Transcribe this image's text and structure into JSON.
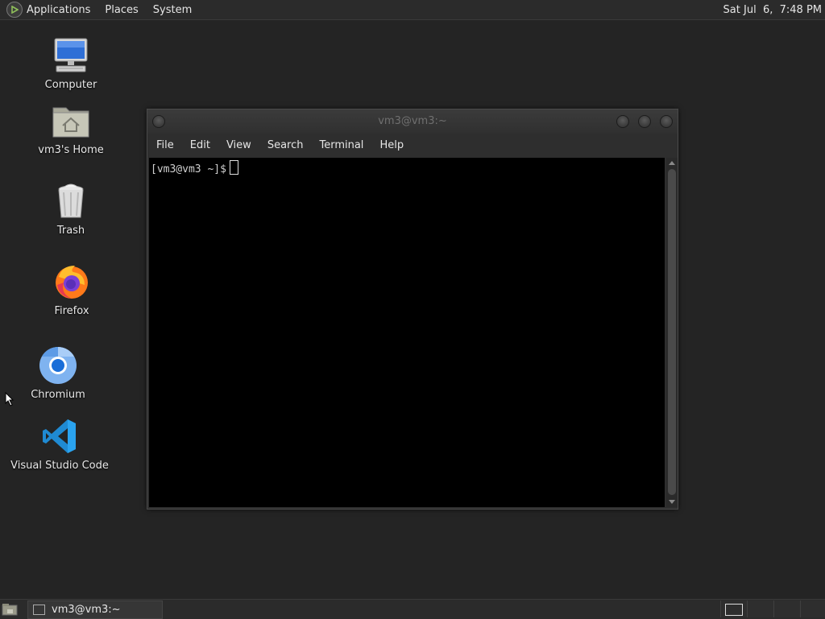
{
  "top_panel": {
    "menus": [
      "Applications",
      "Places",
      "System"
    ],
    "clock": "Sat Jul  6,  7:48 PM"
  },
  "desktop_icons": [
    {
      "label": "Computer",
      "icon": "computer-icon"
    },
    {
      "label": "vm3's Home",
      "icon": "home-folder-icon"
    },
    {
      "label": "Trash",
      "icon": "trash-icon"
    },
    {
      "label": "Firefox",
      "icon": "firefox-icon"
    },
    {
      "label": "Chromium",
      "icon": "chromium-icon"
    },
    {
      "label": "Visual Studio Code",
      "icon": "vscode-icon"
    }
  ],
  "terminal": {
    "title": "vm3@vm3:~",
    "menu": [
      "File",
      "Edit",
      "View",
      "Search",
      "Terminal",
      "Help"
    ],
    "prompt": "[vm3@vm3 ~]$"
  },
  "taskbar": {
    "window_label": "vm3@vm3:~"
  },
  "colors": {
    "desktop_bg": "#242424",
    "panel_bg": "#2b2b2b",
    "terminal_bg": "#000000"
  }
}
